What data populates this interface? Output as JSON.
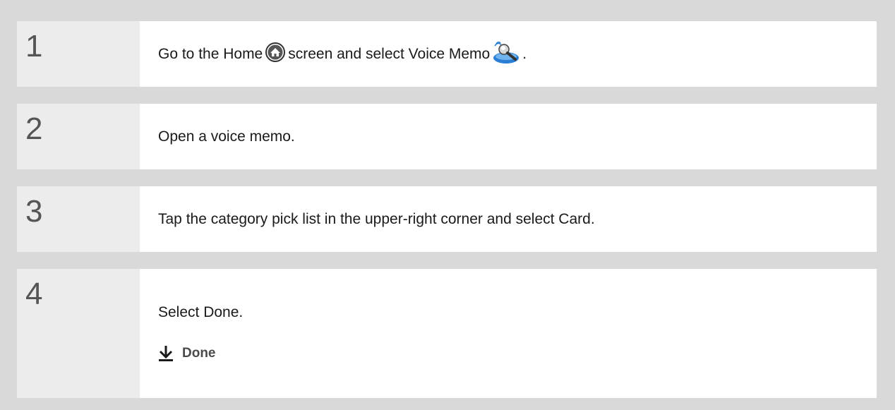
{
  "steps": [
    {
      "number": "1",
      "parts": {
        "a": "Go to the Home",
        "b": "screen and select Voice Memo",
        "c": "."
      },
      "icons": [
        "home-icon",
        "voice-memo-icon"
      ]
    },
    {
      "number": "2",
      "text": "Open a voice memo."
    },
    {
      "number": "3",
      "text": "Tap the category pick list in the upper-right corner and select Card."
    },
    {
      "number": "4",
      "text": "Select Done.",
      "done_label": "Done",
      "done_icon": "arrow-down-done-icon"
    }
  ],
  "colors": {
    "background": "#d9d9d9",
    "number_cell": "#ececec",
    "content_cell": "#ffffff",
    "icon_blue": "#2a7fd4"
  }
}
